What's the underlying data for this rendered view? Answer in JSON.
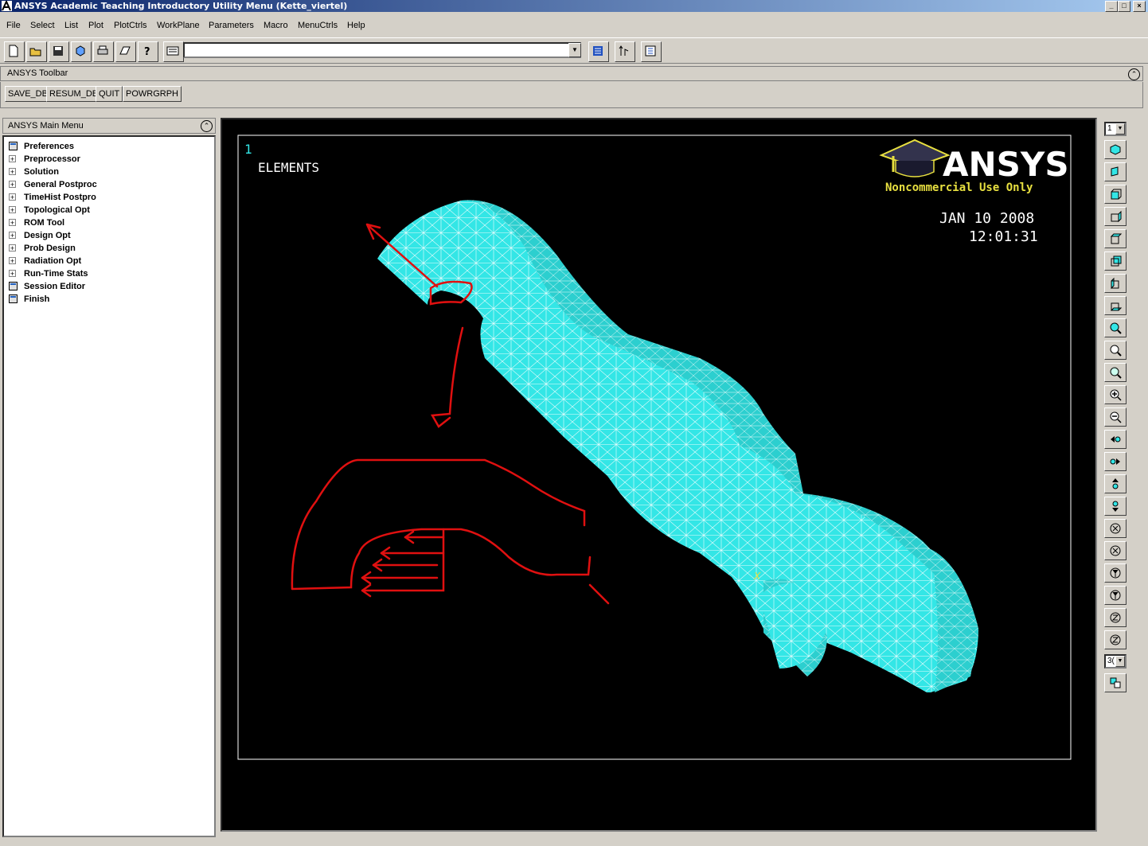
{
  "window": {
    "title": "ANSYS Academic Teaching Introductory Utility Menu (Kette_viertel)"
  },
  "menubar": {
    "items": [
      {
        "label": "File"
      },
      {
        "label": "Select"
      },
      {
        "label": "List"
      },
      {
        "label": "Plot"
      },
      {
        "label": "PlotCtrls"
      },
      {
        "label": "WorkPlane"
      },
      {
        "label": "Parameters"
      },
      {
        "label": "Macro"
      },
      {
        "label": "MenuCtrls"
      },
      {
        "label": "Help"
      }
    ]
  },
  "command_input": {
    "value": ""
  },
  "ansys_toolbar": {
    "title": "ANSYS Toolbar",
    "buttons": [
      {
        "label": "SAVE_DB"
      },
      {
        "label": "RESUM_DB"
      },
      {
        "label": "QUIT"
      },
      {
        "label": "POWRGRPH"
      }
    ]
  },
  "main_menu": {
    "title": "ANSYS Main Menu",
    "items": [
      {
        "label": "Preferences",
        "kind": "leaf"
      },
      {
        "label": "Preprocessor",
        "kind": "expand"
      },
      {
        "label": "Solution",
        "kind": "expand"
      },
      {
        "label": "General Postproc",
        "kind": "expand"
      },
      {
        "label": "TimeHist Postpro",
        "kind": "expand"
      },
      {
        "label": "Topological Opt",
        "kind": "expand"
      },
      {
        "label": "ROM Tool",
        "kind": "expand"
      },
      {
        "label": "Design Opt",
        "kind": "expand"
      },
      {
        "label": "Prob Design",
        "kind": "expand"
      },
      {
        "label": "Radiation Opt",
        "kind": "expand"
      },
      {
        "label": "Run-Time Stats",
        "kind": "expand"
      },
      {
        "label": "Session Editor",
        "kind": "leaf"
      },
      {
        "label": "Finish",
        "kind": "leaf"
      }
    ]
  },
  "graphics": {
    "window_number": "1",
    "plot_label": "ELEMENTS",
    "logo_text": "ANSYS",
    "logo_sub": "Noncommercial Use Only",
    "date": "JAN 10 2008",
    "time": "12:01:31",
    "axis_label": "X",
    "mesh_color": "#33e6e6",
    "annotation_color": "#e01010"
  },
  "right_toolbar": {
    "window_select": "1",
    "zoom_select": "3("
  }
}
